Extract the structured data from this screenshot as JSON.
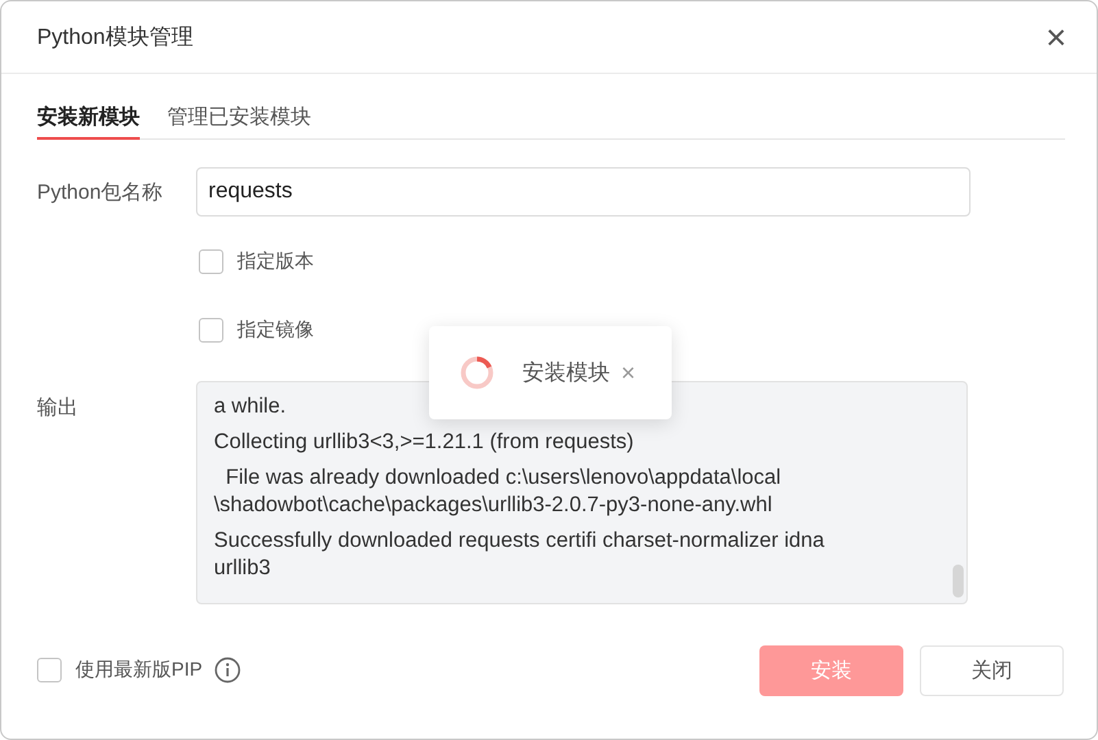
{
  "window": {
    "title": "Python模块管理",
    "close": "×"
  },
  "tabs": [
    {
      "label": "安装新模块",
      "selected": true
    },
    {
      "label": "管理已安装模块",
      "selected": false
    }
  ],
  "package": {
    "label": "Python包名称",
    "value": "requests"
  },
  "options": [
    {
      "label": "指定版本",
      "checked": false
    },
    {
      "label": "指定镜像",
      "checked": false
    }
  ],
  "output": {
    "label": "输出",
    "entries": [
      {
        "lines": [
          "a while."
        ]
      },
      {
        "lines": [
          "Collecting urllib3<3,>=1.21.1 (from requests)"
        ]
      },
      {
        "lines": [
          "  File was already downloaded c:\\users\\lenovo\\appdata\\local",
          "\\shadowbot\\cache\\packages\\urllib3-2.0.7-py3-none-any.whl"
        ]
      },
      {
        "lines": [
          "Successfully downloaded requests certifi charset-normalizer idna",
          "urllib3"
        ]
      }
    ]
  },
  "toast": {
    "text": "安装模块",
    "close": "×"
  },
  "footer": {
    "latest_pip": {
      "label": "使用最新版PIP",
      "checked": false
    },
    "buttons": [
      {
        "label": "安装",
        "kind": "primary",
        "disabled": true
      },
      {
        "label": "关闭",
        "kind": "default",
        "disabled": false
      }
    ]
  }
}
